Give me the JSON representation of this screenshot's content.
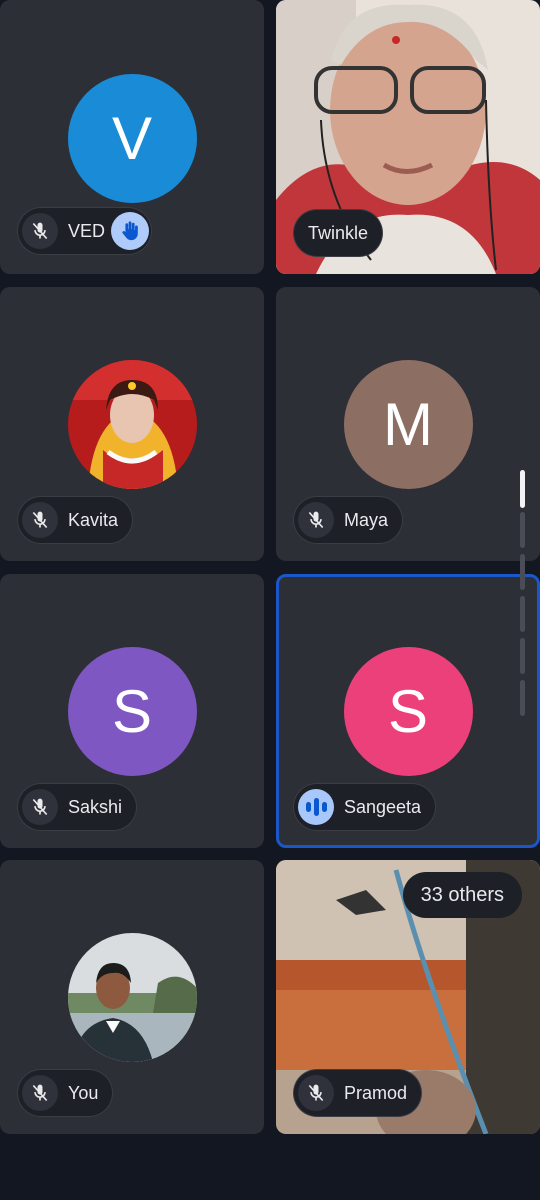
{
  "participants": [
    {
      "name": "VED",
      "initial": "V",
      "avatar_color": "#1a8bd6",
      "muted": true,
      "hand_raised": true
    },
    {
      "name": "Twinkle",
      "video": true
    },
    {
      "name": "Kavita",
      "muted": true,
      "photo_avatar": true
    },
    {
      "name": "Maya",
      "initial": "M",
      "avatar_color": "#8d6e63",
      "muted": true
    },
    {
      "name": "Sakshi",
      "initial": "S",
      "avatar_color": "#7e57c2",
      "muted": true
    },
    {
      "name": "Sangeeta",
      "initial": "S",
      "avatar_color": "#ec407a",
      "speaking": true
    },
    {
      "name": "You",
      "muted": true,
      "photo_avatar": true
    },
    {
      "name": "Pramod",
      "muted": true,
      "video": true
    }
  ],
  "others_badge": "33 others",
  "colors": {
    "background": "#131721",
    "tile": "#2d2f37",
    "active_border": "#1b57c8"
  }
}
